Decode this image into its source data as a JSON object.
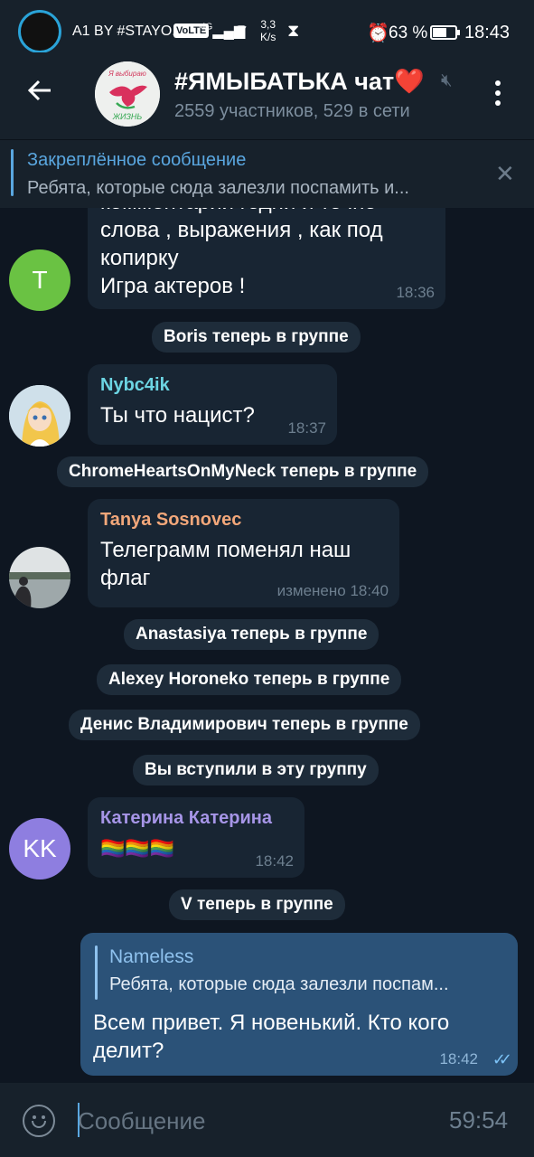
{
  "status_bar": {
    "carrier": "A1 BY #STAYO...",
    "volte": "VoLTE",
    "signal": "4G",
    "speed_value": "3,3",
    "speed_unit": "K/s",
    "battery_pct": "63 %",
    "battery_level": 0.63,
    "time": "18:43",
    "icons": [
      "wifi-icon",
      "hourglass-icon",
      "alarm-icon",
      "battery-icon"
    ]
  },
  "header": {
    "title": "#ЯМЫБАТЬКА чат❤️",
    "subtitle": "2559 участников, 529 в сети",
    "avatar_text_top": "Я выбираю",
    "avatar_text_bottom": "ЖИЗНЬ"
  },
  "pinned": {
    "title": "Закреплённое сообщение",
    "text": "Ребята, которые сюда залезли поспамить и..."
  },
  "messages": [
    {
      "type": "incoming",
      "avatar_letter": "T",
      "avatar_color": "#6ac243",
      "lines": [
        "комментарии годни и точно",
        "слова , выражения , как под",
        "копирку",
        "Игра актеров !"
      ],
      "time": "18:36"
    },
    {
      "type": "service",
      "text": "Boris теперь в группе"
    },
    {
      "type": "incoming",
      "sender": "Nybc4ik",
      "sender_color": "#6cd5e3",
      "text": "Ты что нацист?",
      "time": "18:37"
    },
    {
      "type": "service",
      "text": "ChromeHeartsOnMyNeck теперь в группе"
    },
    {
      "type": "incoming",
      "sender": "Tanya Sosnovec",
      "sender_color": "#f2a77a",
      "lines": [
        "Телеграмм поменял наш",
        "флаг"
      ],
      "time": "изменено 18:40"
    },
    {
      "type": "service",
      "text": "Anastasiya теперь в группе"
    },
    {
      "type": "service",
      "text": "Alexey Horoneko теперь в группе"
    },
    {
      "type": "service",
      "text": "Денис Владимирович теперь в группе"
    },
    {
      "type": "service",
      "text": "Вы вступили в эту группу"
    },
    {
      "type": "incoming",
      "sender": "Катерина Катерина",
      "sender_color": "#a695e7",
      "avatar_letter": "KK",
      "avatar_color": "#8e7ee0",
      "text": "🏳️‍🌈🏳️‍🌈🏳️‍🌈",
      "time": "18:42"
    },
    {
      "type": "service",
      "text": "V теперь в группе"
    },
    {
      "type": "outgoing",
      "reply_name": "Nameless",
      "reply_text": "Ребята, которые сюда залезли поспам...",
      "lines": [
        "Всем привет. Я новенький. Кто кого",
        "делит?"
      ],
      "time": "18:42"
    }
  ],
  "input": {
    "placeholder": "Сообщение",
    "timer": "59:54"
  },
  "colors": {
    "background": "#0e1621",
    "bar": "#17212b",
    "incoming_bubble": "#182533",
    "outgoing_bubble": "#2b5278",
    "accent": "#5aa7e0"
  }
}
